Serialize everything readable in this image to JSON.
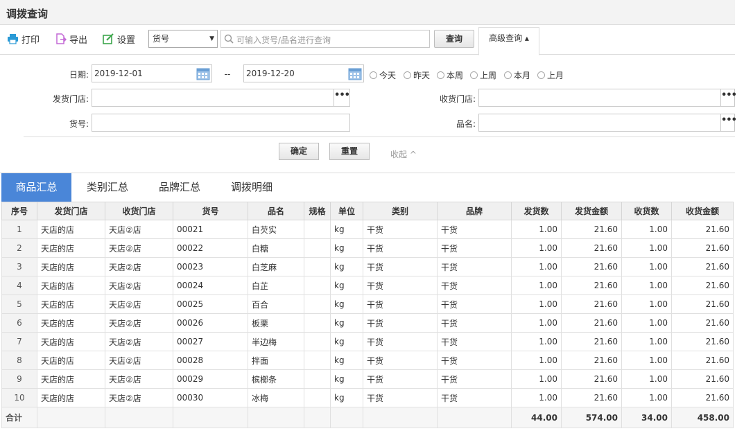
{
  "page": {
    "title": "调拨查询"
  },
  "toolbar": {
    "print_label": "打印",
    "export_label": "导出",
    "settings_label": "设置",
    "field_select": "货号",
    "search_placeholder": "可输入货号/品名进行查询",
    "query_label": "查询",
    "advanced_label": "高级查询 ▴"
  },
  "filters": {
    "date_label": "日期:",
    "date_from": "2019-12-01",
    "date_sep": "--",
    "date_to": "2019-12-20",
    "quick_ranges": [
      "今天",
      "昨天",
      "本周",
      "上周",
      "本月",
      "上月"
    ],
    "from_store_label": "发货门店:",
    "to_store_label": "收货门店:",
    "item_no_label": "货号:",
    "item_name_label": "品名:",
    "confirm_label": "确定",
    "reset_label": "重置",
    "collapse_label": "收起 ^"
  },
  "tabs": [
    "商品汇总",
    "类别汇总",
    "品牌汇总",
    "调拨明细"
  ],
  "table": {
    "headers": [
      "序号",
      "发货门店",
      "收货门店",
      "货号",
      "品名",
      "规格",
      "单位",
      "类别",
      "品牌",
      "发货数",
      "发货金额",
      "收货数",
      "收货金额"
    ],
    "rows": [
      [
        "1",
        "天店的店",
        "天店②店",
        "00021",
        "白芡实",
        "",
        "kg",
        "干货",
        "干货",
        "1.00",
        "21.60",
        "1.00",
        "21.60"
      ],
      [
        "2",
        "天店的店",
        "天店②店",
        "00022",
        "白糖",
        "",
        "kg",
        "干货",
        "干货",
        "1.00",
        "21.60",
        "1.00",
        "21.60"
      ],
      [
        "3",
        "天店的店",
        "天店②店",
        "00023",
        "白芝麻",
        "",
        "kg",
        "干货",
        "干货",
        "1.00",
        "21.60",
        "1.00",
        "21.60"
      ],
      [
        "4",
        "天店的店",
        "天店②店",
        "00024",
        "白芷",
        "",
        "kg",
        "干货",
        "干货",
        "1.00",
        "21.60",
        "1.00",
        "21.60"
      ],
      [
        "5",
        "天店的店",
        "天店②店",
        "00025",
        "百合",
        "",
        "kg",
        "干货",
        "干货",
        "1.00",
        "21.60",
        "1.00",
        "21.60"
      ],
      [
        "6",
        "天店的店",
        "天店②店",
        "00026",
        "板栗",
        "",
        "kg",
        "干货",
        "干货",
        "1.00",
        "21.60",
        "1.00",
        "21.60"
      ],
      [
        "7",
        "天店的店",
        "天店②店",
        "00027",
        "半边梅",
        "",
        "kg",
        "干货",
        "干货",
        "1.00",
        "21.60",
        "1.00",
        "21.60"
      ],
      [
        "8",
        "天店的店",
        "天店②店",
        "00028",
        "拌面",
        "",
        "kg",
        "干货",
        "干货",
        "1.00",
        "21.60",
        "1.00",
        "21.60"
      ],
      [
        "9",
        "天店的店",
        "天店②店",
        "00029",
        "槟榔条",
        "",
        "kg",
        "干货",
        "干货",
        "1.00",
        "21.60",
        "1.00",
        "21.60"
      ],
      [
        "10",
        "天店的店",
        "天店②店",
        "00030",
        "冰梅",
        "",
        "kg",
        "干货",
        "干货",
        "1.00",
        "21.60",
        "1.00",
        "21.60"
      ]
    ],
    "total": [
      "合计",
      "",
      "",
      "",
      "",
      "",
      "",
      "",
      "",
      "44.00",
      "574.00",
      "34.00",
      "458.00"
    ]
  },
  "colors": {
    "accent": "#4a86d8",
    "print_icon": "#2a9ad6",
    "export_icon": "#c46ad6",
    "settings_icon": "#3aa54a"
  }
}
